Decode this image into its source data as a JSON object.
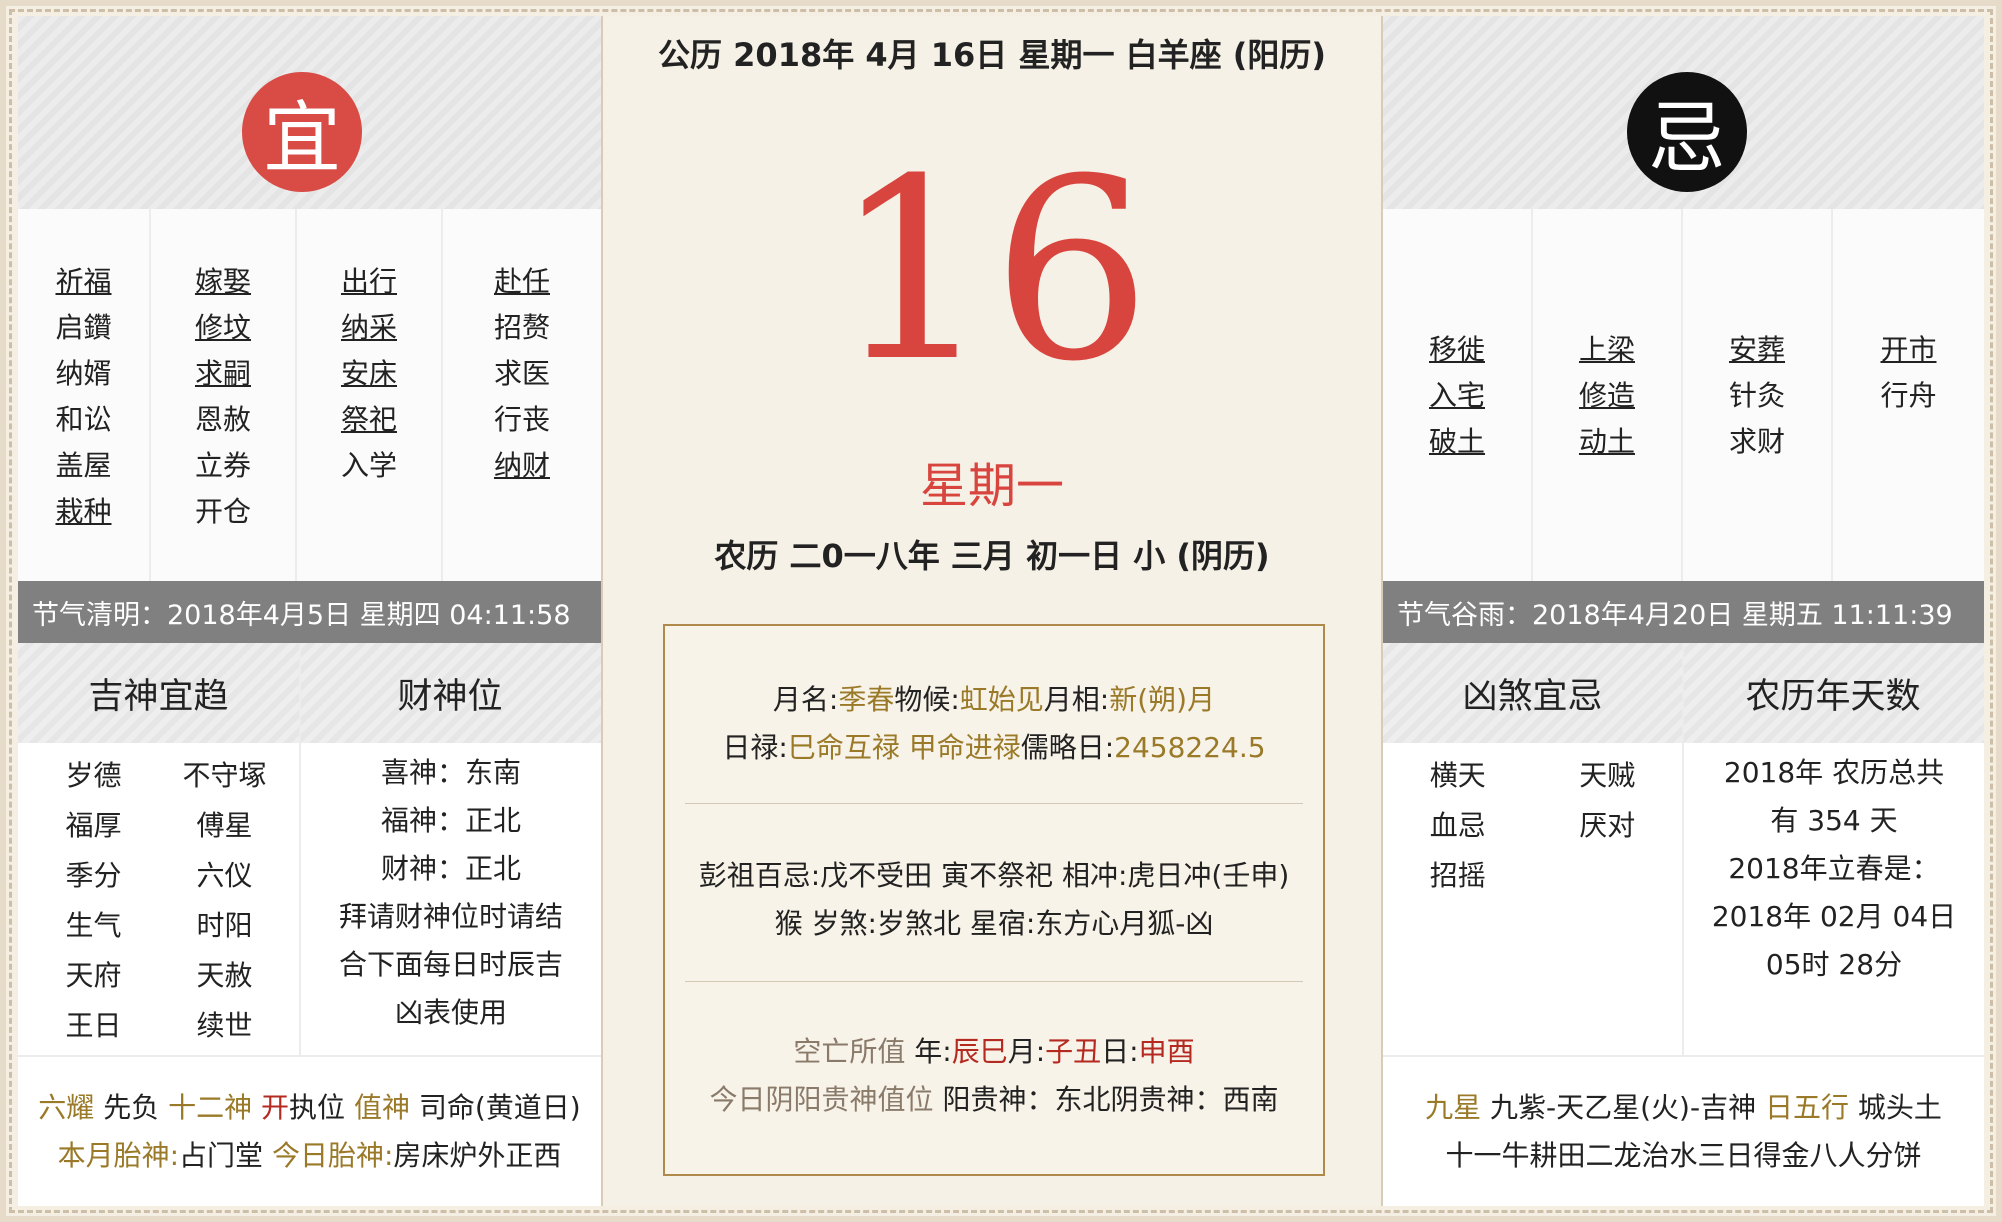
{
  "yi": {
    "badge": "宜",
    "columns": [
      [
        {
          "t": "祈福",
          "link": true
        },
        {
          "t": "启鑽",
          "link": false
        },
        {
          "t": "纳婿",
          "link": false
        },
        {
          "t": "和讼",
          "link": false
        },
        {
          "t": "盖屋",
          "link": false
        },
        {
          "t": "栽种",
          "link": true
        }
      ],
      [
        {
          "t": "嫁娶",
          "link": true
        },
        {
          "t": "修坟",
          "link": true
        },
        {
          "t": "求嗣",
          "link": true
        },
        {
          "t": "恩赦",
          "link": false
        },
        {
          "t": "立券",
          "link": false
        },
        {
          "t": "开仓",
          "link": false
        }
      ],
      [
        {
          "t": "出行",
          "link": true
        },
        {
          "t": "纳采",
          "link": true
        },
        {
          "t": "安床",
          "link": true
        },
        {
          "t": "祭祀",
          "link": true
        },
        {
          "t": "入学",
          "link": false
        }
      ],
      [
        {
          "t": "赴任",
          "link": true
        },
        {
          "t": "招赘",
          "link": false
        },
        {
          "t": "求医",
          "link": false
        },
        {
          "t": "行丧",
          "link": false
        },
        {
          "t": "纳财",
          "link": true
        }
      ]
    ]
  },
  "ji": {
    "badge": "忌",
    "columns": [
      [
        {
          "t": "移徙",
          "link": true
        },
        {
          "t": "入宅",
          "link": true
        },
        {
          "t": "破土",
          "link": true
        }
      ],
      [
        {
          "t": "上梁",
          "link": true
        },
        {
          "t": "修造",
          "link": true
        },
        {
          "t": "动土",
          "link": true
        }
      ],
      [
        {
          "t": "安葬",
          "link": true
        },
        {
          "t": "针灸",
          "link": false
        },
        {
          "t": "求财",
          "link": false
        }
      ],
      [
        {
          "t": "开市",
          "link": true
        },
        {
          "t": "行舟",
          "link": false
        }
      ]
    ]
  },
  "left_solar_term": "节气清明：2018年4月5日 星期四 04:11:58",
  "right_solar_term": "节气谷雨：2018年4月20日 星期五 11:11:39",
  "jishen": {
    "title": "吉神宜趋",
    "items": [
      "岁德",
      "不守塚",
      "福厚",
      "傅星",
      "季分",
      "六仪",
      "生气",
      "时阳",
      "天府",
      "天赦",
      "王日",
      "续世"
    ]
  },
  "caishen": {
    "title": "财神位",
    "lines": [
      "喜神：东南",
      "福神：正北",
      "财神：正北",
      "拜请财神位时请结",
      "合下面每日时辰吉",
      "凶表使用"
    ]
  },
  "xiongsha": {
    "title": "凶煞宜忌",
    "items": [
      "横天",
      "天贼",
      "血忌",
      "厌对",
      "招摇"
    ]
  },
  "lunar_year": {
    "title": "农历年天数",
    "lines": [
      "2018年 农历总共",
      "有 354 天",
      "2018年立春是：",
      "2018年 02月 04日",
      "05时 28分"
    ]
  },
  "left_footer": {
    "l1_k1": "六耀",
    "l1_v1": " 先负 ",
    "l1_k2": "十二神",
    "l1_v2a": " ",
    "l1_v2red": "开",
    "l1_v2b": "执位 ",
    "l1_k3": "值神",
    "l1_v3": " 司命(黄道日)",
    "l2_k1": "本月胎神:",
    "l2_v1": "占门堂 ",
    "l2_k2": "今日胎神:",
    "l2_v2": "房床炉外正西"
  },
  "right_footer": {
    "l1_k1": "九星",
    "l1_v1": " 九紫-天乙星(火)-吉神 ",
    "l1_k2": "日五行",
    "l1_v2": " 城头土",
    "l2": "十一牛耕田二龙治水三日得金八人分饼"
  },
  "center": {
    "title": "公历 2018年 4月 16日 星期一 白羊座 (阳历)",
    "day": "16",
    "weekday": "星期一",
    "lunar": "农历 二0一八年 三月 初一日 小 (阴历)",
    "box": {
      "s1_k1": "月名:",
      "s1_v1": "季春",
      "s1_k2": "物候:",
      "s1_v2": "虹始见",
      "s1_k3": "月相:",
      "s1_v3": "新(朔)月",
      "s1b_k1": "日禄:",
      "s1b_v1": "巳命互禄 甲命进禄",
      "s1b_k2": "儒略日:",
      "s1b_v2": "2458224.5",
      "s2_l1": "彭祖百忌:戊不受田 寅不祭祀  相冲:虎日冲(壬申)",
      "s2_l2": "猴  岁煞:岁煞北  星宿:东方心月狐-凶",
      "s3_k0": "空亡所值 ",
      "s3_k1": "年:",
      "s3_v1": "辰巳",
      "s3_k2": "月:",
      "s3_v2": "子丑",
      "s3_k3": "日:",
      "s3_v3": "申酉",
      "s3b_k0": "今日阴阳贵神值位 ",
      "s3b_v": "阳贵神：东北阴贵神：西南"
    }
  }
}
